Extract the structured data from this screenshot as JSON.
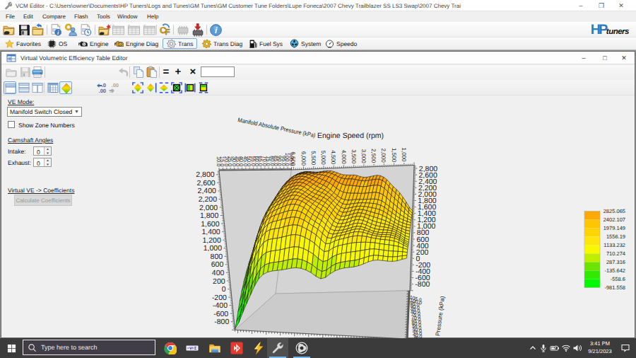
{
  "window": {
    "title": "VCM Editor - C:\\Users\\owner\\Documents\\HP Tuners\\Logs and Tunes\\GM Tunes\\GM Customer Tune Folders\\Lupe Foneca\\2007 Chevy Trailblazer SS LS3 Swap\\2007 Chevy Trai",
    "controls": {
      "minimize": "–",
      "maximize": "❐",
      "close": "✕"
    }
  },
  "menu": {
    "items": [
      "File",
      "Edit",
      "Compare",
      "Flash",
      "Tools",
      "Window",
      "Help"
    ]
  },
  "toolbar": {
    "icons": [
      "open-file",
      "save-file",
      "close-file",
      "file-info",
      "license-key",
      "file-history",
      "new-compare",
      "table-1",
      "table-2",
      "table-3",
      "compare-cf",
      "read-vehicle",
      "write-vehicle",
      "info"
    ],
    "logo_hp": "HP",
    "logo_tuners": "tuners"
  },
  "tabs": [
    {
      "label": "Favorites",
      "icon": "star"
    },
    {
      "label": "OS",
      "icon": "chip"
    },
    {
      "label": "Engine",
      "icon": "engine"
    },
    {
      "label": "Engine Diag",
      "icon": "engine-yellow"
    },
    {
      "label": "Trans",
      "icon": "gear-gray",
      "selected": true
    },
    {
      "label": "Trans Diag",
      "icon": "gear-yellow"
    },
    {
      "label": "Fuel Sys",
      "icon": "fuel-pump"
    },
    {
      "label": "System",
      "icon": "fan"
    },
    {
      "label": "Speedo",
      "icon": "speedometer"
    }
  ],
  "editor": {
    "title": "Virtual Volumetric Efficiency Table Editor",
    "controls": {
      "minimize": "–",
      "maximize": "□",
      "close": "✕"
    },
    "toolbar1": [
      "open",
      "save",
      "print",
      "undo",
      "copy",
      "paste",
      "equals",
      "plus",
      "multiply"
    ],
    "expression_value": "",
    "toolbar2": [
      "view-single",
      "view-hsplit",
      "view-vsplit",
      "view-table",
      "view-surface",
      "dec-less",
      "dec-more",
      "fit-3d",
      "rotate-3d",
      "flatten-3d",
      "mesh-x",
      "bands-v",
      "bands-h"
    ],
    "operator_glyphs": {
      "equals": "=",
      "plus": "+",
      "multiply": "×"
    }
  },
  "panel": {
    "ve_mode_label": "VE Mode:",
    "ve_mode_value": "Manifold Switch Closed",
    "show_zone_label": "Show Zone Numbers",
    "show_zone_checked": false,
    "camshaft_label": "Camshaft Angles",
    "intake_label": "Intake:",
    "intake_value": "0",
    "exhaust_label": "Exhaust:",
    "exhaust_value": "0",
    "virtual_ve_label": "Virtual VE -> Coefficients",
    "calc_button": "Calculate Coefficients"
  },
  "chart_data": {
    "type": "surface3d",
    "x_title": "Engine Speed (rpm)",
    "y_title": "Manifold Absolute Pressure (kPa)",
    "x_axis": {
      "label_ticks": [
        "6,500",
        "6,000",
        "5,500",
        "5,000",
        "4,500",
        "4,000",
        "3,500",
        "3,000",
        "2,500",
        "2,000",
        "1,500",
        "1,000"
      ],
      "values": [
        6500,
        6000,
        5500,
        5000,
        4500,
        4000,
        3500,
        3000,
        2500,
        2000,
        1500,
        1000
      ],
      "range": [
        500,
        6600
      ],
      "minor_step": 100
    },
    "y_axis": {
      "values": [
        10,
        15,
        20,
        25,
        30,
        35,
        40,
        45,
        50,
        55,
        60,
        65,
        70,
        75,
        80,
        85,
        90,
        95,
        100,
        105
      ],
      "range": [
        10,
        105
      ],
      "minor_step": 1
    },
    "z_axis": {
      "values": [
        2800,
        2600,
        2400,
        2200,
        2000,
        1800,
        1600,
        1400,
        1200,
        1000,
        800,
        600,
        400,
        200,
        0,
        -200,
        -400,
        -600,
        -800
      ],
      "range": [
        -1000,
        2900
      ],
      "minor_step": 40
    },
    "legend": {
      "values": [
        2825.065,
        2402.107,
        1979.149,
        1556.19,
        1133.232,
        710.274,
        287.316,
        -135.642,
        -558.6,
        -981.558
      ],
      "colors_bottom_to_top": [
        "#00f800",
        "#30ea00",
        "#6ce400",
        "#c0ee00",
        "#f8f800",
        "#ffe60a",
        "#ffd400",
        "#ffc402",
        "#ffa702"
      ]
    },
    "z_min": -981.558,
    "z_max": 2825.065,
    "grid_rpm_cols": 38,
    "grid_map_rows": 20,
    "z_grid": [
      [
        -981,
        -810,
        -573,
        -346,
        -130,
        88,
        268,
        378,
        440,
        470,
        488,
        504,
        526,
        551,
        563,
        552,
        516,
        460,
        374,
        317,
        351,
        440,
        510,
        556,
        586,
        602,
        617,
        646,
        690,
        741,
        778,
        790,
        781,
        768,
        767,
        782,
        816,
        848
      ],
      [
        -841,
        -651,
        -387,
        -139,
        84,
        301,
        477,
        577,
        626,
        648,
        665,
        687,
        716,
        741,
        747,
        724,
        677,
        612,
        519,
        456,
        492,
        581,
        645,
        682,
        706,
        722,
        737,
        765,
        803,
        841,
        864,
        865,
        852,
        839,
        837,
        847,
        865,
        877
      ],
      [
        -641,
        -422,
        -116,
        162,
        393,
        605,
        770,
        858,
        894,
        910,
        930,
        958,
        989,
        1010,
        1004,
        968,
        910,
        839,
        735,
        659,
        690,
        776,
        831,
        863,
        886,
        904,
        919,
        938,
        960,
        979,
        985,
        975,
        959,
        946,
        939,
        936,
        930,
        916
      ],
      [
        -418,
        -170,
        176,
        485,
        722,
        925,
        1075,
        1149,
        1176,
        1191,
        1215,
        1246,
        1275,
        1285,
        1265,
        1215,
        1151,
        1076,
        963,
        871,
        893,
        970,
        1016,
        1044,
        1070,
        1092,
        1106,
        1113,
        1115,
        1112,
        1102,
        1085,
        1070,
        1058,
        1044,
        1024,
        990,
        952
      ],
      [
        -211,
        57,
        432,
        761,
        998,
        1185,
        1318,
        1380,
        1404,
        1423,
        1453,
        1484,
        1505,
        1500,
        1463,
        1401,
        1332,
        1257,
        1143,
        1039,
        1047,
        1110,
        1146,
        1173,
        1204,
        1231,
        1243,
        1239,
        1222,
        1201,
        1179,
        1161,
        1151,
        1141,
        1121,
        1086,
        1030,
        973
      ],
      [
        -13,
        266,
        658,
        997,
        1225,
        1391,
        1504,
        1560,
        1588,
        1617,
        1650,
        1677,
        1684,
        1661,
        1605,
        1529,
        1454,
        1379,
        1270,
        1160,
        1150,
        1194,
        1219,
        1245,
        1279,
        1309,
        1318,
        1304,
        1273,
        1240,
        1214,
        1198,
        1195,
        1188,
        1163,
        1116,
        1046,
        980
      ],
      [
        187,
        472,
        875,
        1216,
        1428,
        1570,
        1664,
        1717,
        1755,
        1793,
        1827,
        1844,
        1833,
        1791,
        1718,
        1629,
        1548,
        1473,
        1369,
        1254,
        1226,
        1249,
        1266,
        1292,
        1328,
        1357,
        1361,
        1337,
        1297,
        1257,
        1230,
        1219,
        1220,
        1214,
        1184,
        1128,
        1050,
        984
      ],
      [
        384,
        672,
        1078,
        1415,
        1610,
        1727,
        1805,
        1858,
        1906,
        1952,
        1981,
        1984,
        1955,
        1897,
        1813,
        1718,
        1634,
        1556,
        1455,
        1335,
        1291,
        1298,
        1310,
        1339,
        1376,
        1401,
        1397,
        1364,
        1317,
        1275,
        1250,
        1242,
        1244,
        1234,
        1197,
        1136,
        1056,
        994
      ],
      [
        575,
        863,
        1266,
        1594,
        1772,
        1869,
        1935,
        1989,
        2044,
        2090,
        2110,
        2095,
        2049,
        1982,
        1897,
        1807,
        1725,
        1646,
        1541,
        1415,
        1359,
        1357,
        1372,
        1406,
        1444,
        1463,
        1450,
        1409,
        1357,
        1315,
        1291,
        1282,
        1279,
        1259,
        1215,
        1150,
        1074,
        1020
      ],
      [
        757,
        1040,
        1433,
        1747,
        1907,
        1988,
        2046,
        2102,
        2158,
        2198,
        2202,
        2168,
        2107,
        2037,
        1962,
        1885,
        1811,
        1730,
        1620,
        1490,
        1428,
        1426,
        1444,
        1482,
        1518,
        1530,
        1508,
        1462,
        1411,
        1371,
        1345,
        1329,
        1313,
        1281,
        1231,
        1169,
        1102,
        1060
      ],
      [
        937,
        1210,
        1586,
        1881,
        2025,
        2095,
        2148,
        2203,
        2256,
        2284,
        2270,
        2218,
        2146,
        2078,
        2017,
        1954,
        1888,
        1806,
        1689,
        1560,
        1498,
        1500,
        1524,
        1562,
        1592,
        1596,
        1568,
        1522,
        1474,
        1437,
        1408,
        1380,
        1348,
        1302,
        1249,
        1193,
        1138,
        1108
      ],
      [
        1122,
        1382,
        1736,
        2009,
        2138,
        2200,
        2249,
        2302,
        2346,
        2359,
        2329,
        2263,
        2187,
        2125,
        2074,
        2022,
        1959,
        1872,
        1753,
        1632,
        1575,
        1582,
        1609,
        1643,
        1666,
        1662,
        1632,
        1590,
        1549,
        1516,
        1481,
        1438,
        1388,
        1330,
        1273,
        1225,
        1181,
        1158
      ],
      [
        1324,
        1566,
        1893,
        2142,
        2257,
        2314,
        2360,
        2408,
        2439,
        2436,
        2393,
        2321,
        2246,
        2189,
        2144,
        2091,
        2023,
        1931,
        1814,
        1707,
        1659,
        1671,
        1696,
        1724,
        1738,
        1730,
        1702,
        1669,
        1637,
        1606,
        1563,
        1505,
        1440,
        1371,
        1310,
        1266,
        1227,
        1206
      ],
      [
        1548,
        1767,
        2060,
        2281,
        2384,
        2437,
        2479,
        2515,
        2529,
        2509,
        2457,
        2384,
        2314,
        2261,
        2214,
        2154,
        2076,
        1980,
        1871,
        1784,
        1747,
        1762,
        1783,
        1803,
        1810,
        1801,
        1781,
        1759,
        1735,
        1703,
        1652,
        1583,
        1507,
        1431,
        1363,
        1317,
        1277,
        1251
      ],
      [
        1770,
        1963,
        2220,
        2413,
        2505,
        2554,
        2590,
        2612,
        2608,
        2575,
        2520,
        2452,
        2388,
        2336,
        2283,
        2212,
        2125,
        2028,
        1933,
        1868,
        1842,
        1856,
        1870,
        1882,
        1884,
        1879,
        1870,
        1859,
        1840,
        1804,
        1744,
        1664,
        1582,
        1502,
        1426,
        1374,
        1327,
        1291
      ],
      [
        1966,
        2133,
        2355,
        2524,
        2607,
        2652,
        2680,
        2689,
        2671,
        2631,
        2579,
        2519,
        2462,
        2410,
        2349,
        2269,
        2178,
        2087,
        2009,
        1967,
        1949,
        1958,
        1963,
        1965,
        1965,
        1966,
        1967,
        1964,
        1946,
        1903,
        1832,
        1744,
        1660,
        1580,
        1497,
        1435,
        1375,
        1324
      ],
      [
        2196,
        2326,
        2500,
        2634,
        2701,
        2738,
        2756,
        2754,
        2731,
        2695,
        2657,
        2614,
        2570,
        2523,
        2462,
        2383,
        2301,
        2227,
        2173,
        2152,
        2138,
        2137,
        2130,
        2125,
        2125,
        2132,
        2141,
        2143,
        2121,
        2066,
        1979,
        1880,
        1790,
        1704,
        1606,
        1525,
        1438,
        1364
      ],
      [
        2381,
        2475,
        2600,
        2699,
        2751,
        2778,
        2787,
        2780,
        2762,
        2743,
        2727,
        2708,
        2681,
        2643,
        2588,
        2519,
        2454,
        2404,
        2372,
        2367,
        2353,
        2339,
        2321,
        2312,
        2316,
        2329,
        2343,
        2345,
        2315,
        2246,
        2143,
        2031,
        1933,
        1838,
        1723,
        1617,
        1498,
        1400
      ],
      [
        2529,
        2595,
        2686,
        2758,
        2796,
        2811,
        2810,
        2798,
        2786,
        2783,
        2786,
        2785,
        2771,
        2739,
        2690,
        2636,
        2590,
        2562,
        2548,
        2550,
        2532,
        2506,
        2482,
        2474,
        2484,
        2503,
        2517,
        2513,
        2473,
        2394,
        2284,
        2168,
        2068,
        1966,
        1835,
        1705,
        1557,
        1440
      ],
      [
        2600,
        2653,
        2729,
        2791,
        2819,
        2824,
        2814,
        2801,
        2795,
        2804,
        2820,
        2825,
        2820,
        2791,
        2750,
        2709,
        2682,
        2671,
        2665,
        2667,
        2642,
        2607,
        2582,
        2580,
        2597,
        2618,
        2628,
        2613,
        2564,
        2480,
        2372,
        2262,
        2166,
        2060,
        1918,
        1770,
        1603,
        1477
      ]
    ]
  },
  "taskbar": {
    "search_placeholder": "Type here to search",
    "apps": [
      "chrome",
      "media-app",
      "file-explorer",
      "vcm-scanner",
      "vcm-flash",
      "vcm-editor",
      "obs"
    ],
    "tray_icons": [
      "chevron-up",
      "microphone",
      "battery",
      "wifi",
      "speaker"
    ],
    "time": "3:41 PM",
    "date": "9/21/2023",
    "notification": "action-center"
  }
}
